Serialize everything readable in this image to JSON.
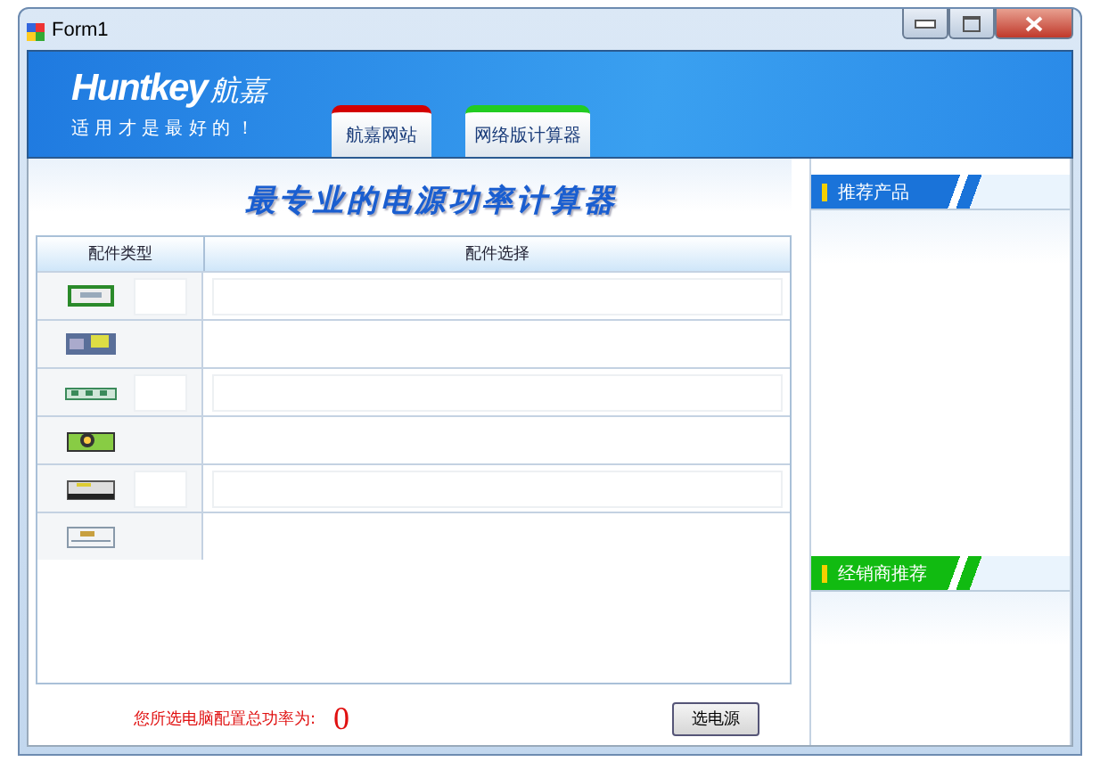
{
  "window": {
    "title": "Form1"
  },
  "banner": {
    "brand": "Huntkey",
    "brand_cn": "航嘉",
    "slogan": "适 用 才 是 最 好 的 ！"
  },
  "tabs": [
    {
      "label": "航嘉网站",
      "color": "#d40000",
      "selected": false
    },
    {
      "label": "网络版计算器",
      "color": "#22cc22",
      "selected": false
    }
  ],
  "heading": "最专业的电源功率计算器",
  "table": {
    "columns": [
      "配件类型",
      "配件选择"
    ],
    "rows": [
      {
        "kind": "field"
      },
      {
        "kind": "plain"
      },
      {
        "kind": "field"
      },
      {
        "kind": "plain"
      },
      {
        "kind": "field"
      },
      {
        "kind": "plain"
      }
    ]
  },
  "total": {
    "label": "您所选电脑配置总功率为:",
    "value": "0"
  },
  "button": "选电源",
  "panels": [
    {
      "title": "推荐产品",
      "color": "#1a73d9"
    },
    {
      "title": "经销商推荐",
      "color": "#11bb11"
    }
  ]
}
